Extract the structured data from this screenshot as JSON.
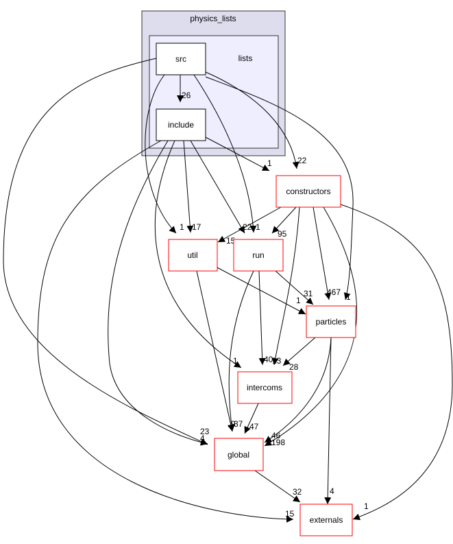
{
  "clusters": {
    "outer": {
      "label": "physics_lists",
      "fill": "#ddddee"
    },
    "inner": {
      "label": "lists",
      "fill": "#eeeeff"
    }
  },
  "nodes": {
    "src": "src",
    "include": "include",
    "constructors": "constructors",
    "util": "util",
    "run": "run",
    "particles": "particles",
    "intercoms": "intercoms",
    "global": "global",
    "externals": "externals"
  },
  "colors": {
    "external_node_border": "#ff0000",
    "local_node_border": "#000000"
  },
  "edges": [
    {
      "from": "src",
      "to": "include",
      "label": "26"
    },
    {
      "from": "src",
      "to": "global",
      "label": "4"
    },
    {
      "from": "src",
      "to": "util",
      "label": "1"
    },
    {
      "from": "src",
      "to": "run",
      "label": "1"
    },
    {
      "from": "src",
      "to": "constructors",
      "label": "22"
    },
    {
      "from": "src",
      "to": "particles",
      "label": "1"
    },
    {
      "from": "include",
      "to": "constructors",
      "label": "1"
    },
    {
      "from": "include",
      "to": "util",
      "label": "17"
    },
    {
      "from": "include",
      "to": "run",
      "label": "22"
    },
    {
      "from": "include",
      "to": "intercoms",
      "label": "1"
    },
    {
      "from": "include",
      "to": "global",
      "label": "23"
    },
    {
      "from": "include",
      "to": "externals",
      "label": "15"
    },
    {
      "from": "constructors",
      "to": "util",
      "label": "15"
    },
    {
      "from": "constructors",
      "to": "run",
      "label": "95"
    },
    {
      "from": "constructors",
      "to": "intercoms",
      "label": "13"
    },
    {
      "from": "constructors",
      "to": "particles",
      "label": "467"
    },
    {
      "from": "constructors",
      "to": "global",
      "label": "46"
    },
    {
      "from": "constructors",
      "to": "externals",
      "label": "1"
    },
    {
      "from": "util",
      "to": "particles",
      "label": "1"
    },
    {
      "from": "util",
      "to": "global",
      "label": "9"
    },
    {
      "from": "run",
      "to": "particles",
      "label": "31"
    },
    {
      "from": "run",
      "to": "intercoms",
      "label": "40"
    },
    {
      "from": "run",
      "to": "global",
      "label": "37"
    },
    {
      "from": "particles",
      "to": "intercoms",
      "label": "28"
    },
    {
      "from": "particles",
      "to": "global",
      "label": "198"
    },
    {
      "from": "particles",
      "to": "externals",
      "label": "4"
    },
    {
      "from": "intercoms",
      "to": "global",
      "label": "47"
    },
    {
      "from": "global",
      "to": "externals",
      "label": "32"
    }
  ]
}
